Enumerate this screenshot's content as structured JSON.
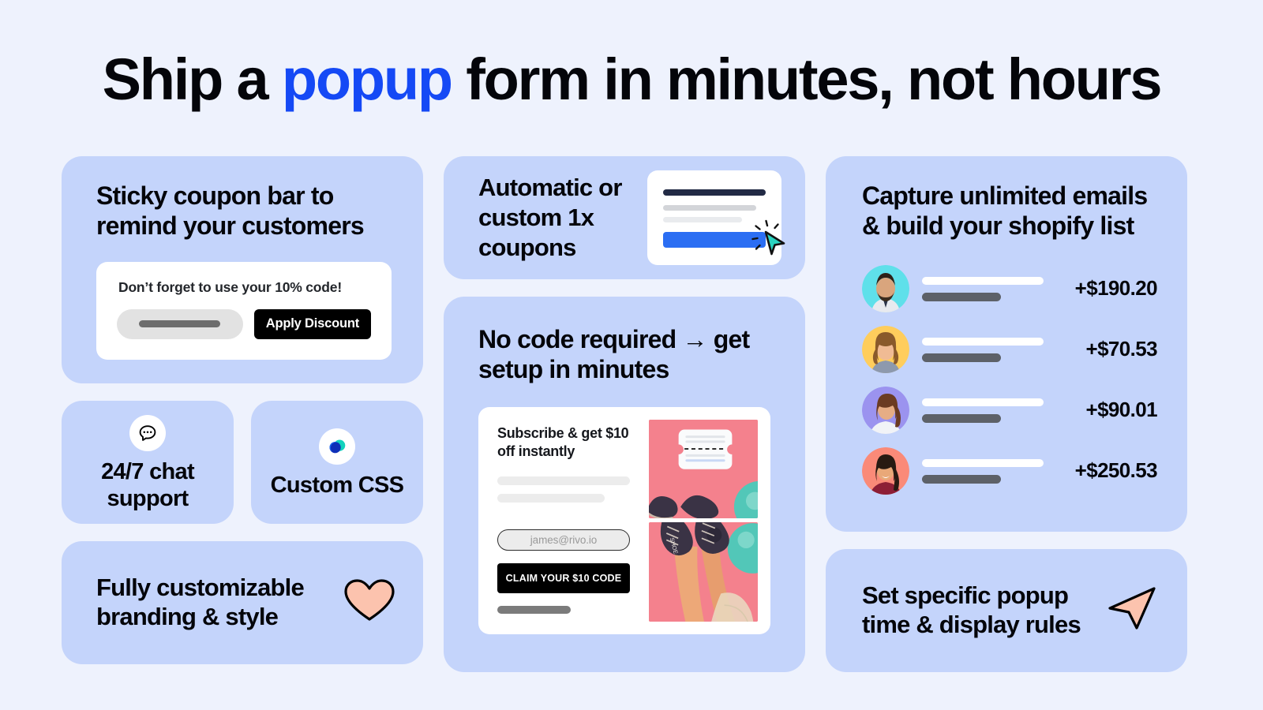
{
  "headline": {
    "before": "Ship a ",
    "accent": "popup",
    "after": " form in minutes, not hours"
  },
  "colors": {
    "page_background": "#eef2fd",
    "card_background": "#c4d4fb",
    "accent_blue": "#1549f5",
    "button_black": "#000000",
    "cursor_teal": "#2ad3c0",
    "heart_peach": "#fcc3ae",
    "photo_pink": "#f4818d"
  },
  "cards": {
    "sticky_coupon": {
      "title": "Sticky coupon bar to remind your customers",
      "bar": {
        "headline": "Don’t forget to use your 10% code!",
        "input_placeholder": "",
        "button_label": "Apply Discount"
      }
    },
    "chat_support": {
      "label": "24/7 chat support",
      "icon": "chat-bubble-icon"
    },
    "custom_css": {
      "label": "Custom CSS",
      "icon": "rivo-logo-icon"
    },
    "fully_customizable": {
      "title": "Fully customizable branding & style",
      "icon": "heart-icon"
    },
    "automatic_coupons": {
      "title": "Automatic or custom 1x coupons",
      "icon": "cursor-click-icon"
    },
    "no_code": {
      "title": "No code required → get setup in minutes",
      "popup": {
        "title": "Subscribe & get $10 off instantly",
        "email_placeholder": "james@rivo.io",
        "button_label": "CLAIM YOUR $10 CODE"
      }
    },
    "capture_emails": {
      "title_before": "Capture ",
      "title_bold": "unlimited",
      "title_after": " emails & build your shopify list",
      "leads": [
        {
          "amount": "+$190.20",
          "avatar_color": "#5fe0ea",
          "skin": "#d9a57d",
          "hair": "#2d2118",
          "shirt": "#e8eaef"
        },
        {
          "amount": "+$70.53",
          "avatar_color": "#ffcd5c",
          "skin": "#f0bb94",
          "hair": "#8a5a2b",
          "shirt": "#8d99ad"
        },
        {
          "amount": "+$90.01",
          "avatar_color": "#9b93ef",
          "skin": "#e6ad85",
          "hair": "#6b3b22",
          "shirt": "#f1f3f7"
        },
        {
          "amount": "+$250.53",
          "avatar_color": "#fa8a78",
          "skin": "#e9a878",
          "hair": "#281a12",
          "shirt": "#8d1e36"
        }
      ]
    },
    "set_specific": {
      "title": "Set specific popup time & display rules",
      "icon": "send-arrow-icon"
    }
  }
}
